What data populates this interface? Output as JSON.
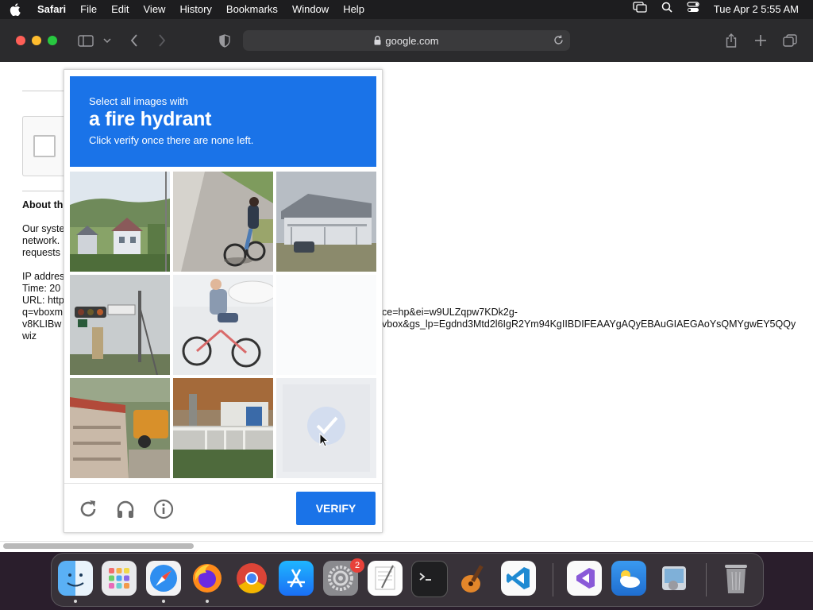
{
  "menubar": {
    "app_name": "Safari",
    "menus": [
      "File",
      "Edit",
      "View",
      "History",
      "Bookmarks",
      "Window",
      "Help"
    ],
    "clock": "Tue Apr 2  5:55 AM"
  },
  "toolbar": {
    "url": "google.com"
  },
  "page": {
    "about_heading": "About th",
    "para_lines": [
      "Our syste",
      "network.",
      "requests"
    ],
    "ip_label": "IP addres",
    "time_label": "Time: 20",
    "url_label": "URL: http",
    "q_label": "q=vboxm",
    "v8_label": "v8KLIBw",
    "wiz_label": "wiz",
    "url_tail_1": "ce=hp&ei=w9ULZqpw7KDk2g-",
    "url_tail_2": "vbox&gs_lp=Egdnd3Mtd2l6IgR2Ym94KgIIBDIFEAAYgAQyEBAuGIAEGAoYsQMYgwEY5QQy"
  },
  "captcha": {
    "instruction_top": "Select all images with",
    "target": "a fire hydrant",
    "instruction_bottom": "Click verify once there are none left.",
    "tiles": [
      {
        "subject": "houses on hillside",
        "state": "normal"
      },
      {
        "subject": "cyclist on road",
        "state": "normal"
      },
      {
        "subject": "house with deck",
        "state": "normal"
      },
      {
        "subject": "traffic light",
        "state": "normal"
      },
      {
        "subject": "cyclist on white bike",
        "state": "normal"
      },
      {
        "subject": "blank",
        "state": "loading"
      },
      {
        "subject": "truck",
        "state": "normal"
      },
      {
        "subject": "street with fence",
        "state": "normal"
      },
      {
        "subject": "selected tile",
        "state": "selected"
      }
    ],
    "verify_label": "VERIFY"
  },
  "dock": {
    "items": [
      "finder",
      "launchpad",
      "safari",
      "firefox",
      "chrome",
      "app-store",
      "system-settings",
      "textedit",
      "terminal",
      "garageband",
      "vscode",
      "visual-studio",
      "weather",
      "preview",
      "trash"
    ],
    "settings_badge": "2"
  },
  "colors": {
    "accent": "#1a73e8",
    "menubar": "#1d1d1f",
    "toolbar": "#2b2b2d"
  }
}
